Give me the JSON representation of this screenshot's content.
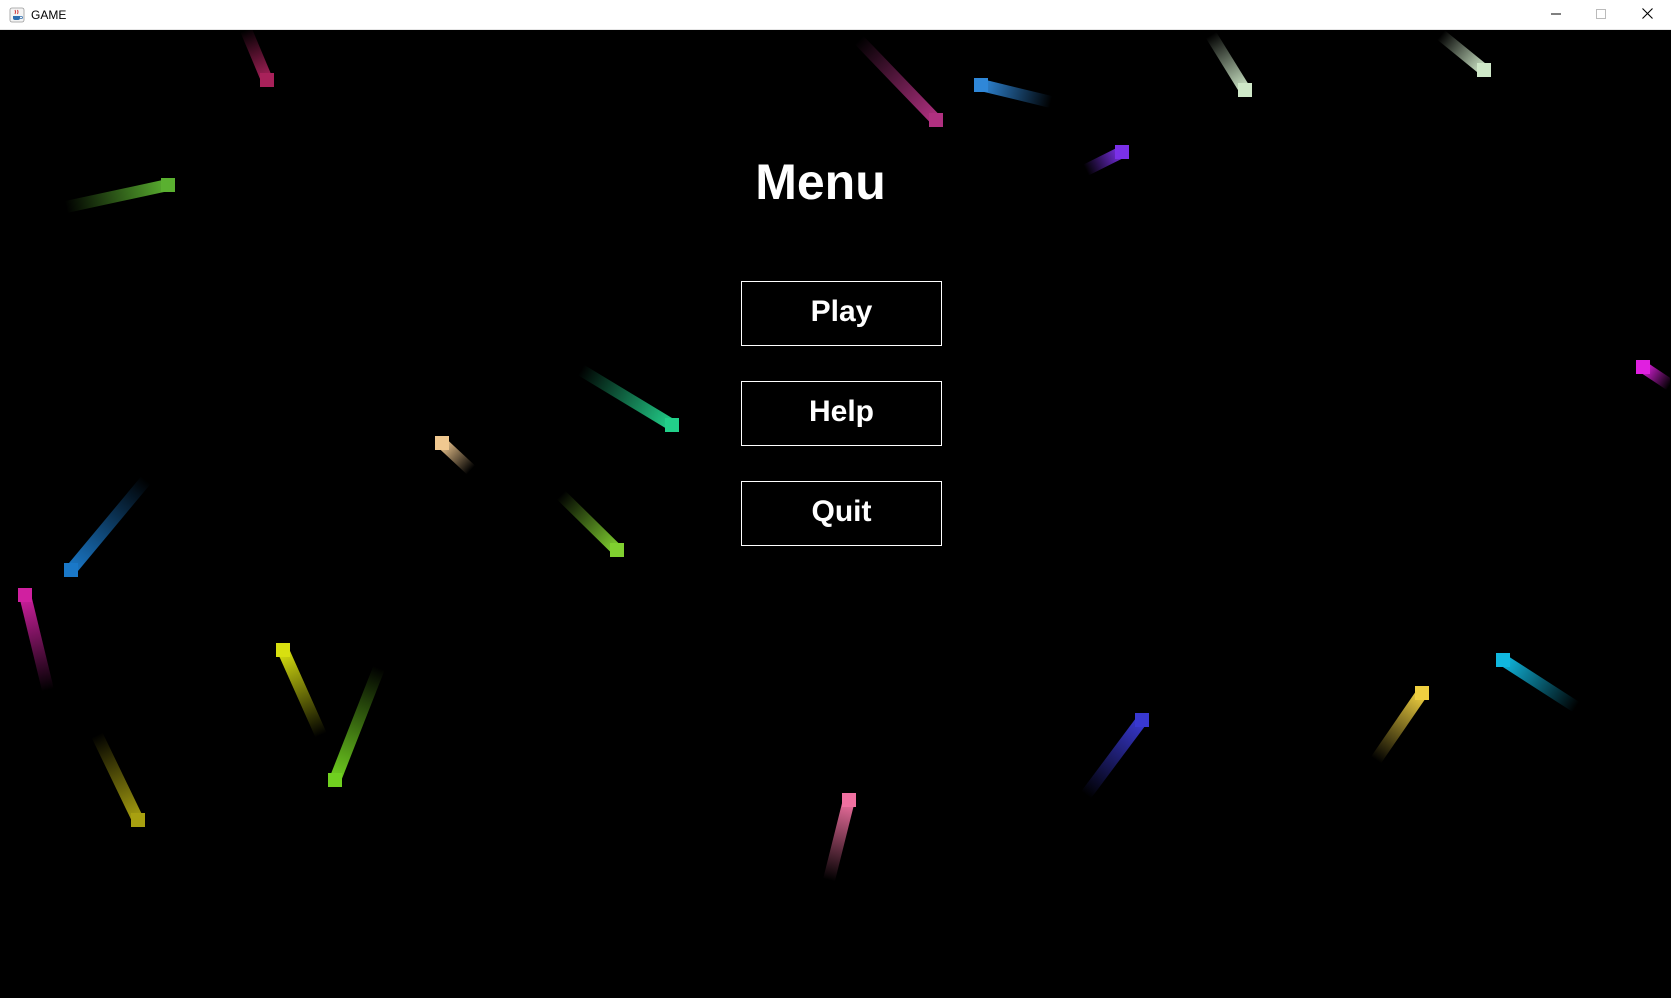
{
  "window": {
    "title": "GAME",
    "icon": "java-cup-icon",
    "controls": [
      "minimize-icon",
      "maximize-icon",
      "close-icon"
    ]
  },
  "menu": {
    "title": "Menu",
    "buttons": [
      {
        "id": "play",
        "label": "Play"
      },
      {
        "id": "help",
        "label": "Help"
      },
      {
        "id": "quit",
        "label": "Quit"
      }
    ]
  },
  "colors": {
    "background": "#000000",
    "text": "#ffffff",
    "button_border": "#ffffff"
  },
  "particle_colors": [
    "#a8215a",
    "#b03080",
    "#2f87d8",
    "#cfe8c8",
    "#cfe8c8",
    "#7a30e8",
    "#5ab030",
    "#22d08a",
    "#f0c890",
    "#1a78c8",
    "#80d030",
    "#d020a0",
    "#d8e010",
    "#70d020",
    "#a8a010",
    "#f070a0",
    "#3838d0",
    "#f0d040",
    "#10b8e0",
    "#e020e0"
  ]
}
